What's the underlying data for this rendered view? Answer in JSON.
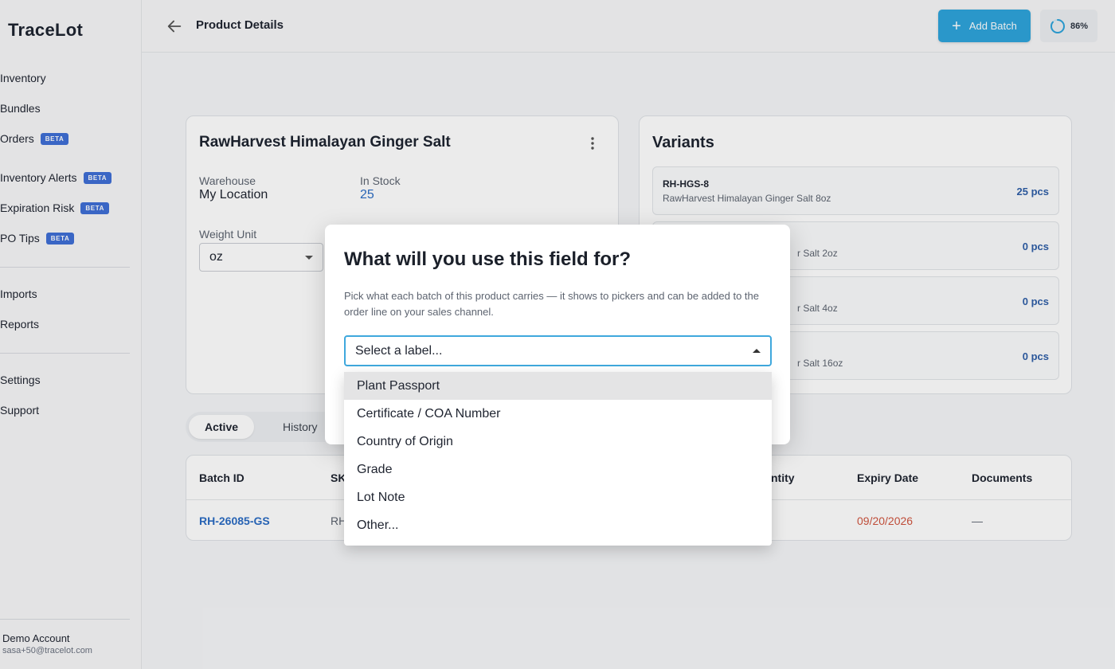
{
  "app": {
    "brand": "TraceLot"
  },
  "sidebar": {
    "items": [
      {
        "label": "Inventory",
        "beta": ""
      },
      {
        "label": "Bundles",
        "beta": ""
      },
      {
        "label": "Orders",
        "beta": "BETA"
      },
      {
        "label": "Inventory Alerts",
        "beta": "BETA"
      },
      {
        "label": "Expiration Risk",
        "beta": "BETA"
      },
      {
        "label": "PO Tips",
        "beta": "BETA"
      },
      {
        "label": "Imports",
        "beta": ""
      },
      {
        "label": "Reports",
        "beta": ""
      },
      {
        "label": "Settings",
        "beta": ""
      },
      {
        "label": "Support",
        "beta": ""
      }
    ],
    "account": {
      "name": "Demo Account",
      "email": "sasa+50@tracelot.com"
    }
  },
  "header": {
    "title": "Product Details",
    "add_batch_label": "Add Batch",
    "progress_text": "86%",
    "progress_value": 0.86
  },
  "product": {
    "name": "RawHarvest Himalayan Ginger Salt",
    "warehouse_label": "Warehouse",
    "warehouse_value": "My Location",
    "stock_label": "In Stock",
    "stock_value": "25",
    "weight_unit_label": "Weight Unit",
    "weight_unit_value": "oz"
  },
  "variants": {
    "title": "Variants",
    "rows": [
      {
        "sku": "RH-HGS-8",
        "name": "RawHarvest Himalayan Ginger Salt 8oz",
        "qty": "25 pcs"
      },
      {
        "sku": "",
        "name": "r Salt 2oz",
        "qty": "0 pcs"
      },
      {
        "sku": "",
        "name": "r Salt 4oz",
        "qty": "0 pcs"
      },
      {
        "sku": "",
        "name": "r Salt 16oz",
        "qty": "0 pcs"
      }
    ]
  },
  "tabs": {
    "active": "Active",
    "history": "History"
  },
  "table": {
    "headers": {
      "batch_id": "Batch ID",
      "sku": "SK",
      "quantity": "ntity",
      "expiry": "Expiry Date",
      "documents": "Documents"
    },
    "row": {
      "batch_id": "RH-26085-GS",
      "sku": "RH",
      "expiry": "09/20/2026",
      "documents": "—"
    }
  },
  "modal": {
    "title": "What will you use this field for?",
    "description": "Pick what each batch of this product carries — it shows to pickers and can be added to the order line on your sales channel.",
    "select_placeholder": "Select a label...",
    "options": [
      "Plant Passport",
      "Certificate / COA Number",
      "Country of Origin",
      "Grade",
      "Lot Note",
      "Other..."
    ]
  },
  "colors": {
    "accent": "#2ea4dc",
    "beta_badge": "#3f6fd6",
    "link": "#2b6cc4",
    "expiry": "#d0543e"
  }
}
